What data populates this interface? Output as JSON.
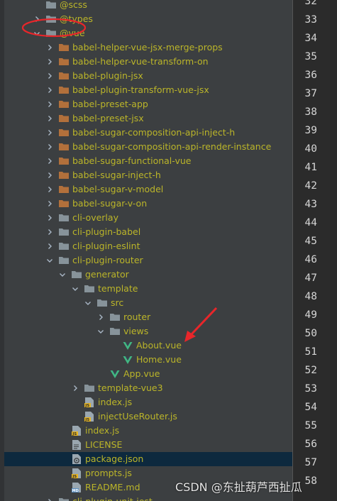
{
  "tree": {
    "rows": [
      {
        "label": "@scss",
        "icon": "folder",
        "arrow": "",
        "depth": 1
      },
      {
        "label": "@types",
        "icon": "folder",
        "arrow": "collapsed",
        "depth": 1
      },
      {
        "label": "@vue",
        "icon": "folder",
        "arrow": "expanded",
        "depth": 1
      },
      {
        "label": "babel-helper-vue-jsx-merge-props",
        "icon": "folder-orange",
        "arrow": "collapsed",
        "depth": 2
      },
      {
        "label": "babel-helper-vue-transform-on",
        "icon": "folder-orange",
        "arrow": "collapsed",
        "depth": 2
      },
      {
        "label": "babel-plugin-jsx",
        "icon": "folder-orange",
        "arrow": "collapsed",
        "depth": 2
      },
      {
        "label": "babel-plugin-transform-vue-jsx",
        "icon": "folder-orange",
        "arrow": "collapsed",
        "depth": 2
      },
      {
        "label": "babel-preset-app",
        "icon": "folder-orange",
        "arrow": "collapsed",
        "depth": 2
      },
      {
        "label": "babel-preset-jsx",
        "icon": "folder-orange",
        "arrow": "collapsed",
        "depth": 2
      },
      {
        "label": "babel-sugar-composition-api-inject-h",
        "icon": "folder-orange",
        "arrow": "collapsed",
        "depth": 2
      },
      {
        "label": "babel-sugar-composition-api-render-instance",
        "icon": "folder-orange",
        "arrow": "collapsed",
        "depth": 2
      },
      {
        "label": "babel-sugar-functional-vue",
        "icon": "folder-orange",
        "arrow": "collapsed",
        "depth": 2
      },
      {
        "label": "babel-sugar-inject-h",
        "icon": "folder-orange",
        "arrow": "collapsed",
        "depth": 2
      },
      {
        "label": "babel-sugar-v-model",
        "icon": "folder-orange",
        "arrow": "collapsed",
        "depth": 2
      },
      {
        "label": "babel-sugar-v-on",
        "icon": "folder-orange",
        "arrow": "collapsed",
        "depth": 2
      },
      {
        "label": "cli-overlay",
        "icon": "folder",
        "arrow": "collapsed",
        "depth": 2
      },
      {
        "label": "cli-plugin-babel",
        "icon": "folder",
        "arrow": "collapsed",
        "depth": 2
      },
      {
        "label": "cli-plugin-eslint",
        "icon": "folder",
        "arrow": "collapsed",
        "depth": 2
      },
      {
        "label": "cli-plugin-router",
        "icon": "folder",
        "arrow": "expanded",
        "depth": 2
      },
      {
        "label": "generator",
        "icon": "folder",
        "arrow": "expanded",
        "depth": 3
      },
      {
        "label": "template",
        "icon": "folder",
        "arrow": "expanded",
        "depth": 4
      },
      {
        "label": "src",
        "icon": "folder",
        "arrow": "expanded",
        "depth": 5
      },
      {
        "label": "router",
        "icon": "folder",
        "arrow": "collapsed",
        "depth": 6
      },
      {
        "label": "views",
        "icon": "folder",
        "arrow": "expanded",
        "depth": 6
      },
      {
        "label": "About.vue",
        "icon": "vue",
        "arrow": "",
        "depth": 7
      },
      {
        "label": "Home.vue",
        "icon": "vue",
        "arrow": "",
        "depth": 7
      },
      {
        "label": "App.vue",
        "icon": "vue",
        "arrow": "",
        "depth": 6
      },
      {
        "label": "template-vue3",
        "icon": "folder",
        "arrow": "collapsed",
        "depth": 4
      },
      {
        "label": "index.js",
        "icon": "js",
        "arrow": "",
        "depth": 4
      },
      {
        "label": "injectUseRouter.js",
        "icon": "js",
        "arrow": "",
        "depth": 4
      },
      {
        "label": "index.js",
        "icon": "js",
        "arrow": "",
        "depth": 3
      },
      {
        "label": "LICENSE",
        "icon": "text",
        "arrow": "",
        "depth": 3
      },
      {
        "label": "package.json",
        "icon": "json",
        "arrow": "",
        "depth": 3,
        "selected": true
      },
      {
        "label": "prompts.js",
        "icon": "js",
        "arrow": "",
        "depth": 3
      },
      {
        "label": "README.md",
        "icon": "md",
        "arrow": "",
        "depth": 3
      },
      {
        "label": "cli-plugin-unit-jest",
        "icon": "folder",
        "arrow": "collapsed",
        "depth": 2
      }
    ]
  },
  "gutter": {
    "line_numbers": [
      "32",
      "33",
      "34",
      "35",
      "36",
      "37",
      "38",
      "39",
      "40",
      "41",
      "42",
      "43",
      "44",
      "45",
      "46",
      "47",
      "48",
      "49",
      "50",
      "51",
      "52",
      "53",
      "54",
      "55",
      "56",
      "57",
      "58"
    ]
  },
  "watermark": "CSDN @东扯葫芦西扯瓜",
  "colors": {
    "panel_bg": "#3c3f41",
    "gutter_bg": "#2b2b2b",
    "folder_grey": "#87939a",
    "folder_orange": "#b2703b",
    "vue_green": "#41b883",
    "selection": "#0d293e",
    "annotation_red": "#e8262a"
  }
}
